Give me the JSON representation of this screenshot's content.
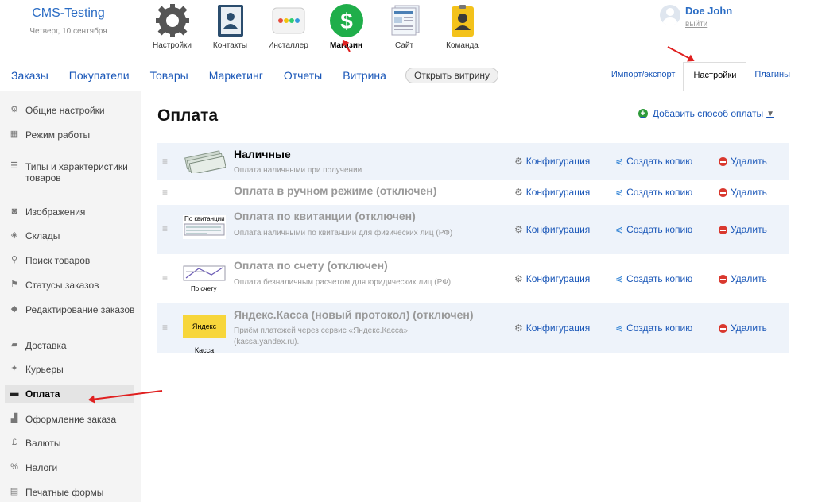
{
  "brand": {
    "name": "CMS-Testing",
    "date": "Четверг, 10 сентября"
  },
  "apps": [
    {
      "label": "Настройки",
      "icon": "gear-icon"
    },
    {
      "label": "Контакты",
      "icon": "contacts-book-icon"
    },
    {
      "label": "Инсталлер",
      "icon": "installer-icon"
    },
    {
      "label": "Магазин",
      "icon": "shop-dollar-icon"
    },
    {
      "label": "Сайт",
      "icon": "site-pages-icon"
    },
    {
      "label": "Команда",
      "icon": "team-badge-icon"
    }
  ],
  "user": {
    "name": "Doe John",
    "logout": "выйти"
  },
  "nav": {
    "items": [
      "Заказы",
      "Покупатели",
      "Товары",
      "Маркетинг",
      "Отчеты",
      "Витрина"
    ],
    "storefront_button": "Открыть витрину",
    "right_tabs": [
      "Импорт/экспорт",
      "Настройки",
      "Плагины"
    ],
    "active_right_tab": "Настройки"
  },
  "sidebar": {
    "items": [
      {
        "label": "Общие настройки",
        "icon": "gears-icon"
      },
      {
        "label": "Режим работы",
        "icon": "calendar-icon"
      },
      {
        "label": "Типы и характеристики товаров",
        "icon": "list-icon"
      },
      {
        "label": "Изображения",
        "icon": "camera-icon"
      },
      {
        "label": "Склады",
        "icon": "boxes-icon"
      },
      {
        "label": "Поиск товаров",
        "icon": "magnifier-icon"
      },
      {
        "label": "Статусы заказов",
        "icon": "flag-icon"
      },
      {
        "label": "Редактирование заказов",
        "icon": "layers-icon"
      },
      {
        "label": "Доставка",
        "icon": "truck-icon"
      },
      {
        "label": "Курьеры",
        "icon": "runner-icon"
      },
      {
        "label": "Оплата",
        "icon": "payment-card-icon"
      },
      {
        "label": "Оформление заказа",
        "icon": "cart-icon"
      },
      {
        "label": "Валюты",
        "icon": "pound-icon"
      },
      {
        "label": "Налоги",
        "icon": "percent-icon"
      },
      {
        "label": "Печатные формы",
        "icon": "printer-icon"
      }
    ],
    "active": "Оплата"
  },
  "main": {
    "title": "Оплата",
    "add_method": "Добавить способ оплаты",
    "actions": {
      "configure": "Конфигурация",
      "copy": "Создать копию",
      "delete": "Удалить"
    },
    "methods": [
      {
        "title": "Наличные",
        "description": "Оплата наличными при получении",
        "thumb": "cash-banknotes-icon",
        "thumb_text": ""
      },
      {
        "title": "Оплата в ручном режиме (отключен)",
        "description": "",
        "thumb": "",
        "thumb_text": ""
      },
      {
        "title": "Оплата по квитанции (отключен)",
        "description": "Оплата наличными по квитанции для физических лиц (РФ)",
        "thumb": "receipt-icon",
        "thumb_text": "По квитанции"
      },
      {
        "title": "Оплата по счету (отключен)",
        "description": "Оплата безналичным расчетом для юридических лиц (РФ)",
        "thumb": "invoice-icon",
        "thumb_text": "По счету"
      },
      {
        "title": "Яндекс.Касса (новый протокол) (отключен)",
        "description": "Приём платежей через сервис «Яндекс.Касса» (kassa.yandex.ru).",
        "thumb": "yandex-kassa-logo",
        "thumb_text": "Яндекс Касса"
      }
    ]
  },
  "colors": {
    "link": "#1a57b8",
    "accent_green": "#2e9a3a",
    "delete_red": "#d9382e",
    "row_alt": "#eef3fa",
    "annotation_arrow": "#e02020"
  }
}
